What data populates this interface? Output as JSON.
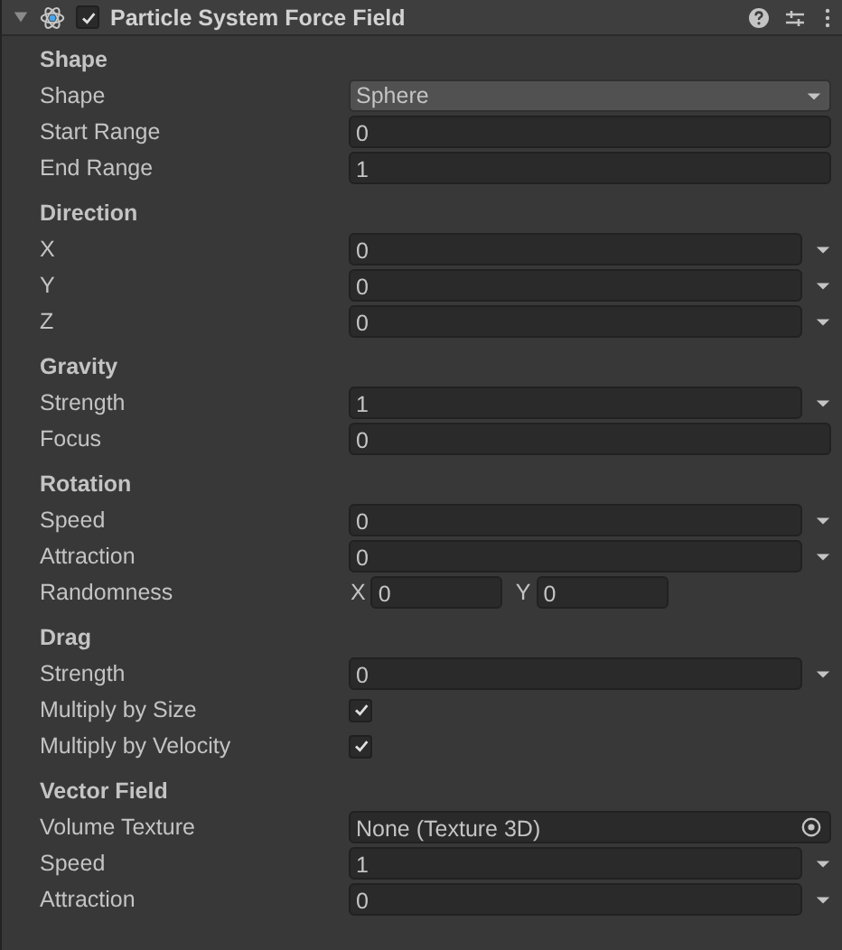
{
  "header": {
    "title": "Particle System Force Field",
    "expanded": true,
    "enabled": true
  },
  "sections": [
    {
      "title": "Shape",
      "rows": [
        {
          "kind": "dropdown",
          "label": "Shape",
          "value": "Sphere"
        },
        {
          "kind": "number",
          "label": "Start Range",
          "value": "0"
        },
        {
          "kind": "number",
          "label": "End Range",
          "value": "1"
        }
      ]
    },
    {
      "title": "Direction",
      "rows": [
        {
          "kind": "curve",
          "label": "X",
          "value": "0"
        },
        {
          "kind": "curve",
          "label": "Y",
          "value": "0"
        },
        {
          "kind": "curve",
          "label": "Z",
          "value": "0"
        }
      ]
    },
    {
      "title": "Gravity",
      "rows": [
        {
          "kind": "curve",
          "label": "Strength",
          "value": "1"
        },
        {
          "kind": "number",
          "label": "Focus",
          "value": "0"
        }
      ]
    },
    {
      "title": "Rotation",
      "rows": [
        {
          "kind": "curve",
          "label": "Speed",
          "value": "0"
        },
        {
          "kind": "curve",
          "label": "Attraction",
          "value": "0"
        },
        {
          "kind": "vector2",
          "label": "Randomness",
          "fields": [
            {
              "axis": "X",
              "value": "0"
            },
            {
              "axis": "Y",
              "value": "0"
            }
          ]
        }
      ]
    },
    {
      "title": "Drag",
      "rows": [
        {
          "kind": "curve",
          "label": "Strength",
          "value": "0"
        },
        {
          "kind": "checkbox",
          "label": "Multiply by Size",
          "checked": true
        },
        {
          "kind": "checkbox",
          "label": "Multiply by Velocity",
          "checked": true
        }
      ]
    },
    {
      "title": "Vector Field",
      "rows": [
        {
          "kind": "object",
          "label": "Volume Texture",
          "value": "None (Texture 3D)"
        },
        {
          "kind": "curve",
          "label": "Speed",
          "value": "1"
        },
        {
          "kind": "curve",
          "label": "Attraction",
          "value": "0"
        }
      ]
    }
  ]
}
